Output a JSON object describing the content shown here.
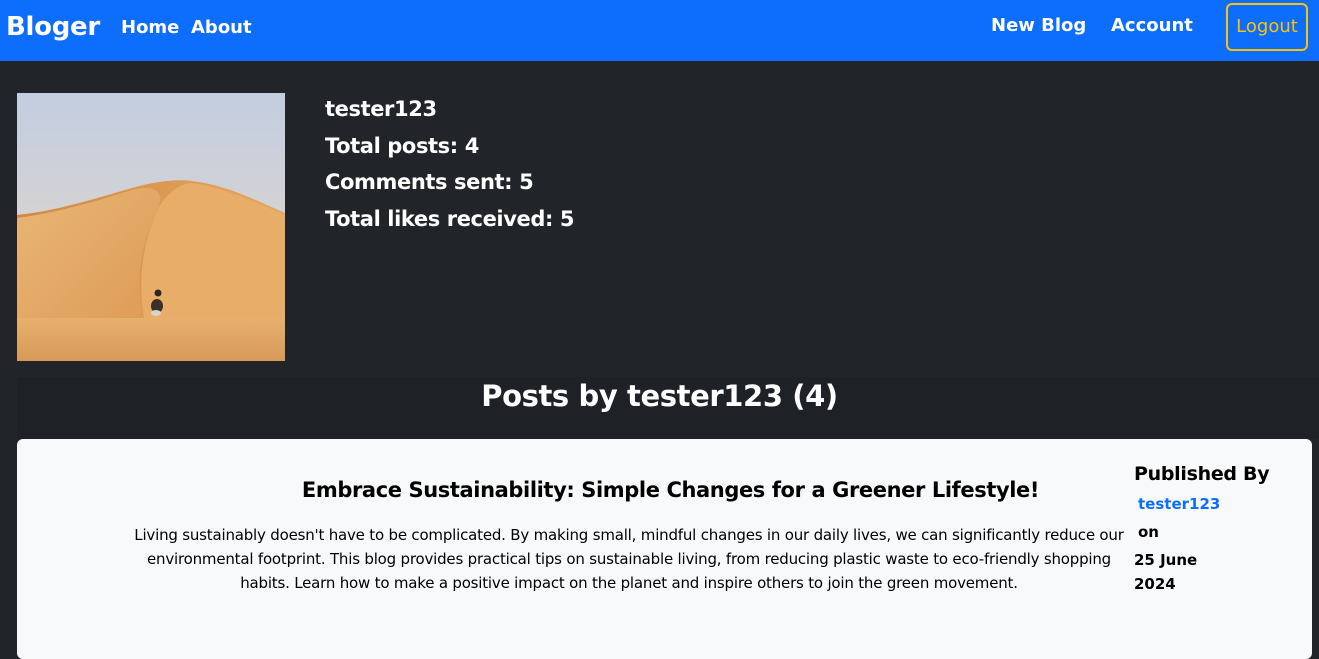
{
  "navbar": {
    "brand": "Bloger",
    "left_links": [
      "Home",
      "About"
    ],
    "right_links": [
      "New Blog",
      "Account"
    ],
    "logout_label": "Logout",
    "colors": {
      "background": "#0d6efd",
      "logout_accent": "#ffc107"
    }
  },
  "profile": {
    "image_alt": "desert dune with motorcyclist",
    "username": "tester123",
    "stats": [
      "Total posts: 4",
      "Comments sent: 5",
      "Total likes received: 5"
    ]
  },
  "posts_section": {
    "heading": "Posts by tester123 (4)"
  },
  "posts": [
    {
      "title": "Embrace Sustainability: Simple Changes for a Greener Lifestyle!",
      "body": "Living sustainably doesn't have to be complicated. By making small, mindful changes in our daily lives, we can significantly reduce our environmental footprint. This blog provides practical tips on sustainable living, from reducing plastic waste to eco-friendly shopping habits. Learn how to make a positive impact on the planet and inspire others to join the green movement.",
      "published_label": "Published By",
      "author": "tester123",
      "on_label": "on",
      "date": "25 June 2024"
    }
  ]
}
